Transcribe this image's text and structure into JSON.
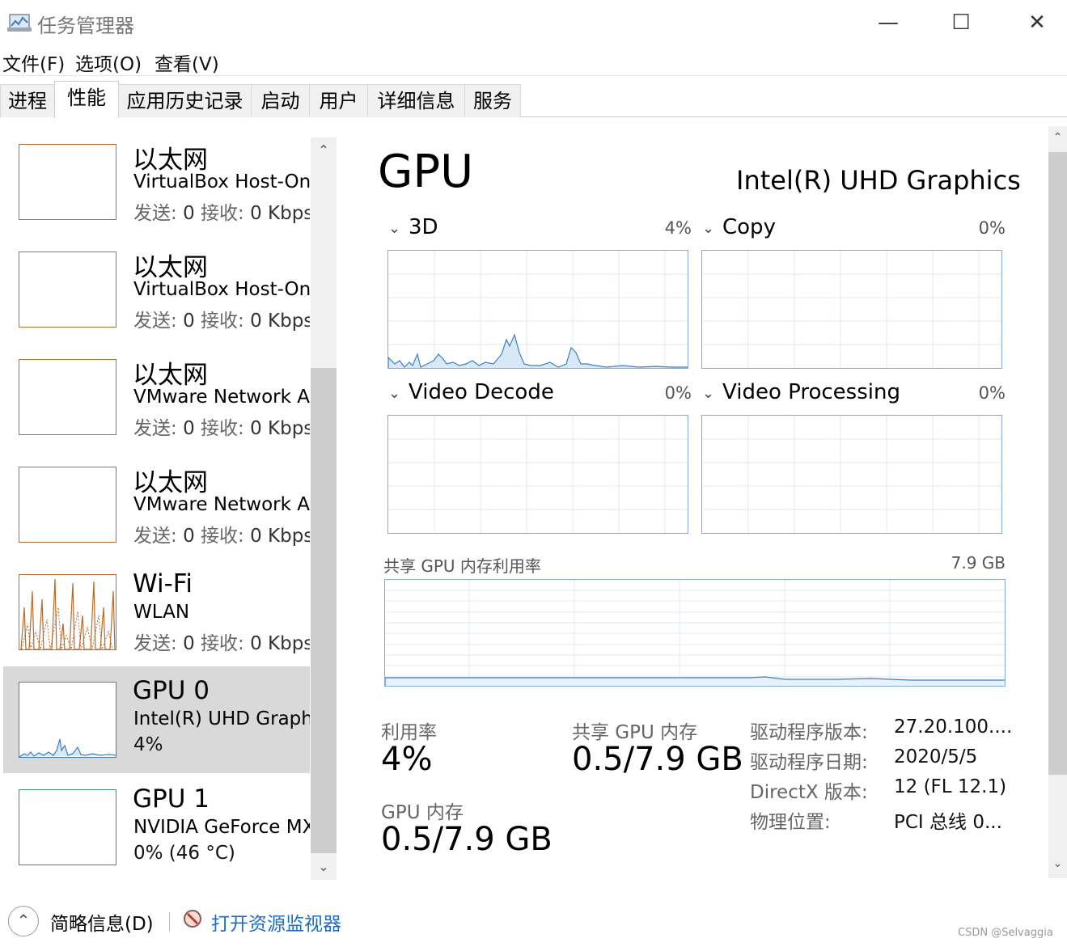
{
  "window": {
    "title": "任务管理器",
    "icon": "task-manager-icon",
    "controls": {
      "minimize": "—",
      "maximize": "☐",
      "close": "✕"
    }
  },
  "menu": [
    "文件(F)",
    "选项(O)",
    "查看(V)"
  ],
  "tabs": [
    "进程",
    "性能",
    "应用历史记录",
    "启动",
    "用户",
    "详细信息",
    "服务"
  ],
  "active_tab": "性能",
  "sidebar": [
    {
      "name": "以太网",
      "sub": "VirtualBox Host-Only",
      "stat_send": "发送:",
      "stat_send_val": "0",
      "stat_recv": "接收:",
      "stat_recv_val": "0 Kbps"
    },
    {
      "name": "以太网",
      "sub": "VirtualBox Host-Only",
      "stat_send": "发送:",
      "stat_send_val": "0",
      "stat_recv": "接收:",
      "stat_recv_val": "0 Kbps"
    },
    {
      "name": "以太网",
      "sub": "VMware Network Adapter",
      "stat_send": "发送:",
      "stat_send_val": "0",
      "stat_recv": "接收:",
      "stat_recv_val": "0 Kbps"
    },
    {
      "name": "以太网",
      "sub": "VMware Network Adapter",
      "stat_send": "发送:",
      "stat_send_val": "0",
      "stat_recv": "接收:",
      "stat_recv_val": "0 Kbps"
    },
    {
      "name": "Wi-Fi",
      "sub": "WLAN",
      "stat_send": "发送:",
      "stat_send_val": "0",
      "stat_recv": "接收:",
      "stat_recv_val": "0 Kbps"
    },
    {
      "name": "GPU 0",
      "sub": "Intel(R) UHD Graphics",
      "stat": "4%"
    },
    {
      "name": "GPU 1",
      "sub": "NVIDIA GeForce MX",
      "stat": "0% (46 °C)"
    }
  ],
  "detail": {
    "title": "GPU",
    "device": "Intel(R) UHD Graphics",
    "engines": [
      {
        "label": "3D",
        "percent": "4%"
      },
      {
        "label": "Copy",
        "percent": "0%"
      },
      {
        "label": "Video Decode",
        "percent": "0%"
      },
      {
        "label": "Video Processing",
        "percent": "0%"
      }
    ],
    "shared_mem_graph": {
      "label": "共享 GPU 内存利用率",
      "max": "7.9 GB"
    },
    "stats": {
      "util_label": "利用率",
      "util_value": "4%",
      "shared_label": "共享 GPU 内存",
      "shared_value": "0.5/7.9 GB",
      "gpumem_label": "GPU 内存",
      "gpumem_value": "0.5/7.9 GB"
    },
    "info": [
      {
        "k": "驱动程序版本:",
        "v": "27.20.100...."
      },
      {
        "k": "驱动程序日期:",
        "v": "2020/5/5"
      },
      {
        "k": "DirectX 版本:",
        "v": "12 (FL 12.1)"
      },
      {
        "k": "物理位置:",
        "v": "PCI 总线 0..."
      }
    ]
  },
  "footer": {
    "summary": "简略信息(D)",
    "monitor": "打开资源监视器"
  },
  "watermark": "CSDN @Selvaggia",
  "colors": {
    "network": "#b86c2c",
    "gpu": "#3b7fc4",
    "grid": "#d5e3f3",
    "selected": "#d9d9d9"
  }
}
